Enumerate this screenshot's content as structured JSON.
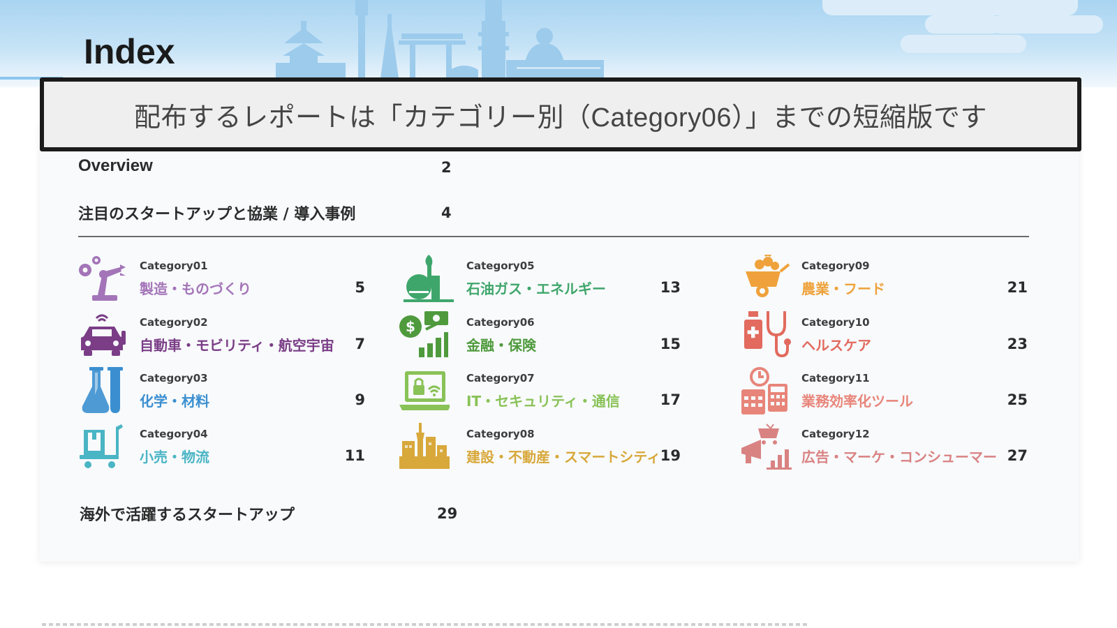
{
  "page": {
    "title": "Index"
  },
  "notice": {
    "text": "配布するレポートは「カテゴリー別（Category06）」までの短縮版です"
  },
  "toc": {
    "overview": {
      "label": "Overview",
      "page": "2"
    },
    "featured": {
      "label": "注目のスタートアップと協業 / 導入事例",
      "page": "4"
    },
    "overseas": {
      "label": "海外で活躍するスタートアップ",
      "page": "29"
    }
  },
  "categories": [
    {
      "code": "Category01",
      "name": "製造・ものづくり",
      "page": "5",
      "color": "#a474b8",
      "icon": "robot-arm-gears-icon"
    },
    {
      "code": "Category02",
      "name": "自動車・モビリティ・航空宇宙",
      "page": "7",
      "color": "#7a3d86",
      "icon": "connected-car-icon"
    },
    {
      "code": "Category03",
      "name": "化学・材料",
      "page": "9",
      "color": "#3b8fd0",
      "icon": "flask-test-tube-icon"
    },
    {
      "code": "Category04",
      "name": "小売・物流",
      "page": "11",
      "color": "#4ab5c4",
      "icon": "delivery-cart-icon"
    },
    {
      "code": "Category05",
      "name": "石油ガス・エネルギー",
      "page": "13",
      "color": "#3fa66b",
      "icon": "oil-plant-icon"
    },
    {
      "code": "Category06",
      "name": "金融・保険",
      "page": "15",
      "color": "#4f9a3d",
      "icon": "money-growth-icon"
    },
    {
      "code": "Category07",
      "name": "IT・セキュリティ・通信",
      "page": "17",
      "color": "#89c257",
      "icon": "secure-laptop-icon"
    },
    {
      "code": "Category08",
      "name": "建設・不動産・スマートシティ",
      "page": "19",
      "color": "#d8a83a",
      "icon": "city-skyline-icon"
    },
    {
      "code": "Category09",
      "name": "農業・フード",
      "page": "21",
      "color": "#efa23b",
      "icon": "harvest-cart-icon"
    },
    {
      "code": "Category10",
      "name": "ヘルスケア",
      "page": "23",
      "color": "#e26a5e",
      "icon": "medicine-stethoscope-icon"
    },
    {
      "code": "Category11",
      "name": "業務効率化ツール",
      "page": "25",
      "color": "#e8857a",
      "icon": "clock-calendar-calculator-icon"
    },
    {
      "code": "Category12",
      "name": "広告・マーケ・コンシューマー",
      "page": "27",
      "color": "#d98282",
      "icon": "megaphone-cart-icon"
    }
  ]
}
